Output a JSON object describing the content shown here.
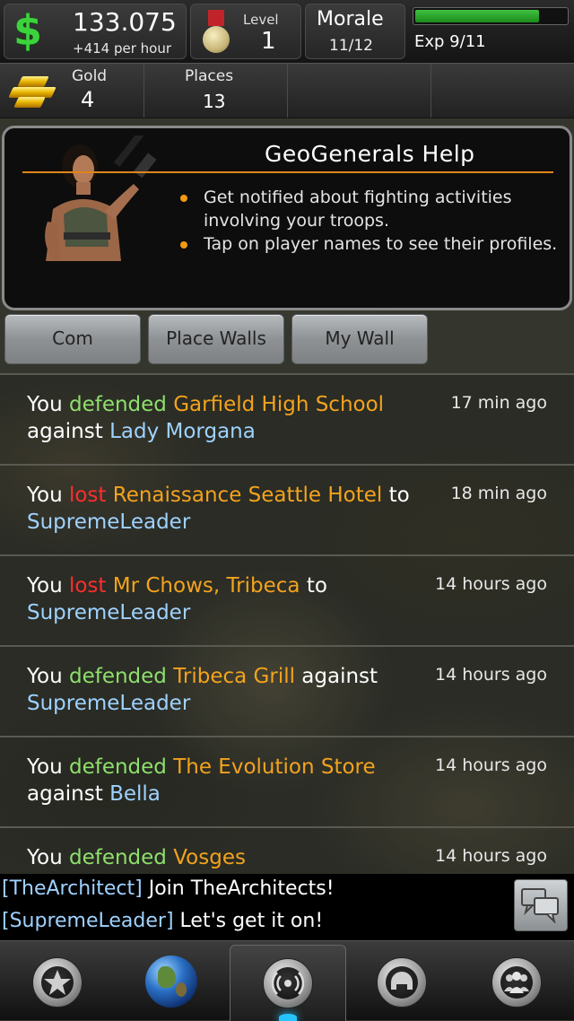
{
  "stats": {
    "money": "133.075",
    "money_rate": "+414 per hour",
    "level_label": "Level",
    "level_value": "1",
    "morale_label": "Morale",
    "morale_value": "11/12",
    "exp_label": "Exp 9/11",
    "exp_fraction": 0.82,
    "money_color": "#3cd23c"
  },
  "resources": {
    "gold_label": "Gold",
    "gold_value": "4",
    "places_label": "Places",
    "places_value": "13"
  },
  "help": {
    "title": "GeoGenerals Help",
    "items": [
      "Get notified about fighting activities involving your troops.",
      "Tap on player names to see their profiles."
    ]
  },
  "tabs": [
    {
      "label": "Com"
    },
    {
      "label": "Place Walls"
    },
    {
      "label": "My Wall"
    }
  ],
  "feed": [
    {
      "you": "You",
      "verb": "defended",
      "place": "Garfield High School",
      "prep": "against",
      "player": "Lady Morgana",
      "time": "17 min ago"
    },
    {
      "you": "You",
      "verb": "lost",
      "place": "Renaissance Seattle Hotel",
      "prep": "to",
      "player": "SupremeLeader",
      "time": "18 min ago"
    },
    {
      "you": "You",
      "verb": "lost",
      "place": "Mr Chows, Tribeca",
      "prep": "to",
      "player": "SupremeLeader",
      "time": "14 hours ago"
    },
    {
      "you": "You",
      "verb": "defended",
      "place": "Tribeca Grill",
      "prep": "against",
      "player": "SupremeLeader",
      "time": "14 hours ago"
    },
    {
      "you": "You",
      "verb": "defended",
      "place": "The Evolution Store",
      "prep": "against",
      "player": "Bella",
      "time": "14 hours ago"
    },
    {
      "you": "You",
      "verb": "defended",
      "place": "Vosges",
      "prep": "",
      "player": "",
      "time": "14 hours ago"
    }
  ],
  "chat": [
    {
      "name": "[TheArchitect]",
      "message": "Join TheArchitects!"
    },
    {
      "name": "[SupremeLeader]",
      "message": "Let's get it on!"
    }
  ],
  "nav": [
    {
      "icon": "star-icon"
    },
    {
      "icon": "globe-icon"
    },
    {
      "icon": "radar-icon"
    },
    {
      "icon": "helmet-icon"
    },
    {
      "icon": "group-icon"
    }
  ]
}
